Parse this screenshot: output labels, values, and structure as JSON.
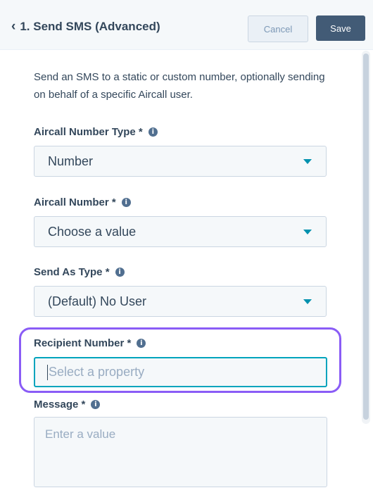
{
  "header": {
    "title": "1. Send SMS (Advanced)",
    "cancel_label": "Cancel",
    "save_label": "Save"
  },
  "description": "Send an SMS to a static or custom number, optionally sending on behalf of a specific Aircall user.",
  "fields": {
    "number_type": {
      "label": "Aircall Number Type *",
      "value": "Number"
    },
    "aircall_number": {
      "label": "Aircall Number *",
      "value": "Choose a value"
    },
    "send_as_type": {
      "label": "Send As Type *",
      "value": "(Default) No User"
    },
    "recipient_number": {
      "label": "Recipient Number *",
      "placeholder": "Select a property"
    },
    "message": {
      "label": "Message *",
      "placeholder": "Enter a value"
    }
  },
  "colors": {
    "accent": "#0091ae",
    "focus": "#00a4bd",
    "highlight": "#8a5cf6",
    "primary_button": "#425b76"
  }
}
